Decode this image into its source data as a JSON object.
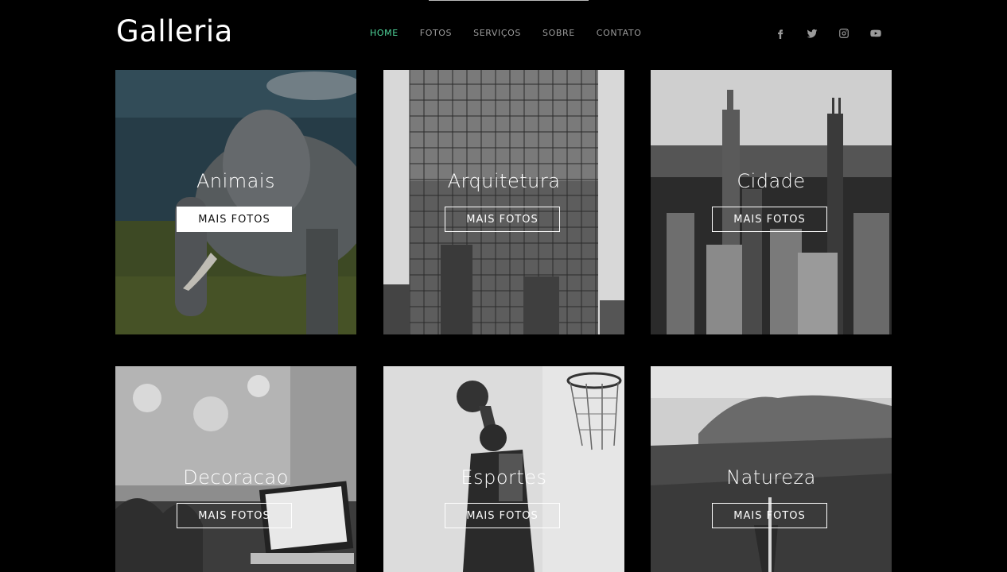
{
  "brand": "Galleria",
  "nav": {
    "home": "HOME",
    "fotos": "FOTOS",
    "servicos": "SERVIÇOS",
    "sobre": "SOBRE",
    "contato": "CONTATO",
    "active_color": "#4fd49a"
  },
  "social": [
    "facebook-icon",
    "twitter-icon",
    "instagram-icon",
    "youtube-icon"
  ],
  "cards": [
    {
      "title": "Animais",
      "button": "MAIS FOTOS",
      "image": "elephant photo"
    },
    {
      "title": "Arquitetura",
      "button": "MAIS FOTOS",
      "image": "glass building photo"
    },
    {
      "title": "Cidade",
      "button": "MAIS FOTOS",
      "image": "city skyline photo"
    },
    {
      "title": "Decoracao",
      "button": "MAIS FOTOS",
      "image": "laptop on desk photo"
    },
    {
      "title": "Esportes",
      "button": "MAIS FOTOS",
      "image": "basketball player photo"
    },
    {
      "title": "Natureza",
      "button": "MAIS FOTOS",
      "image": "mountain waterfall photo"
    }
  ]
}
